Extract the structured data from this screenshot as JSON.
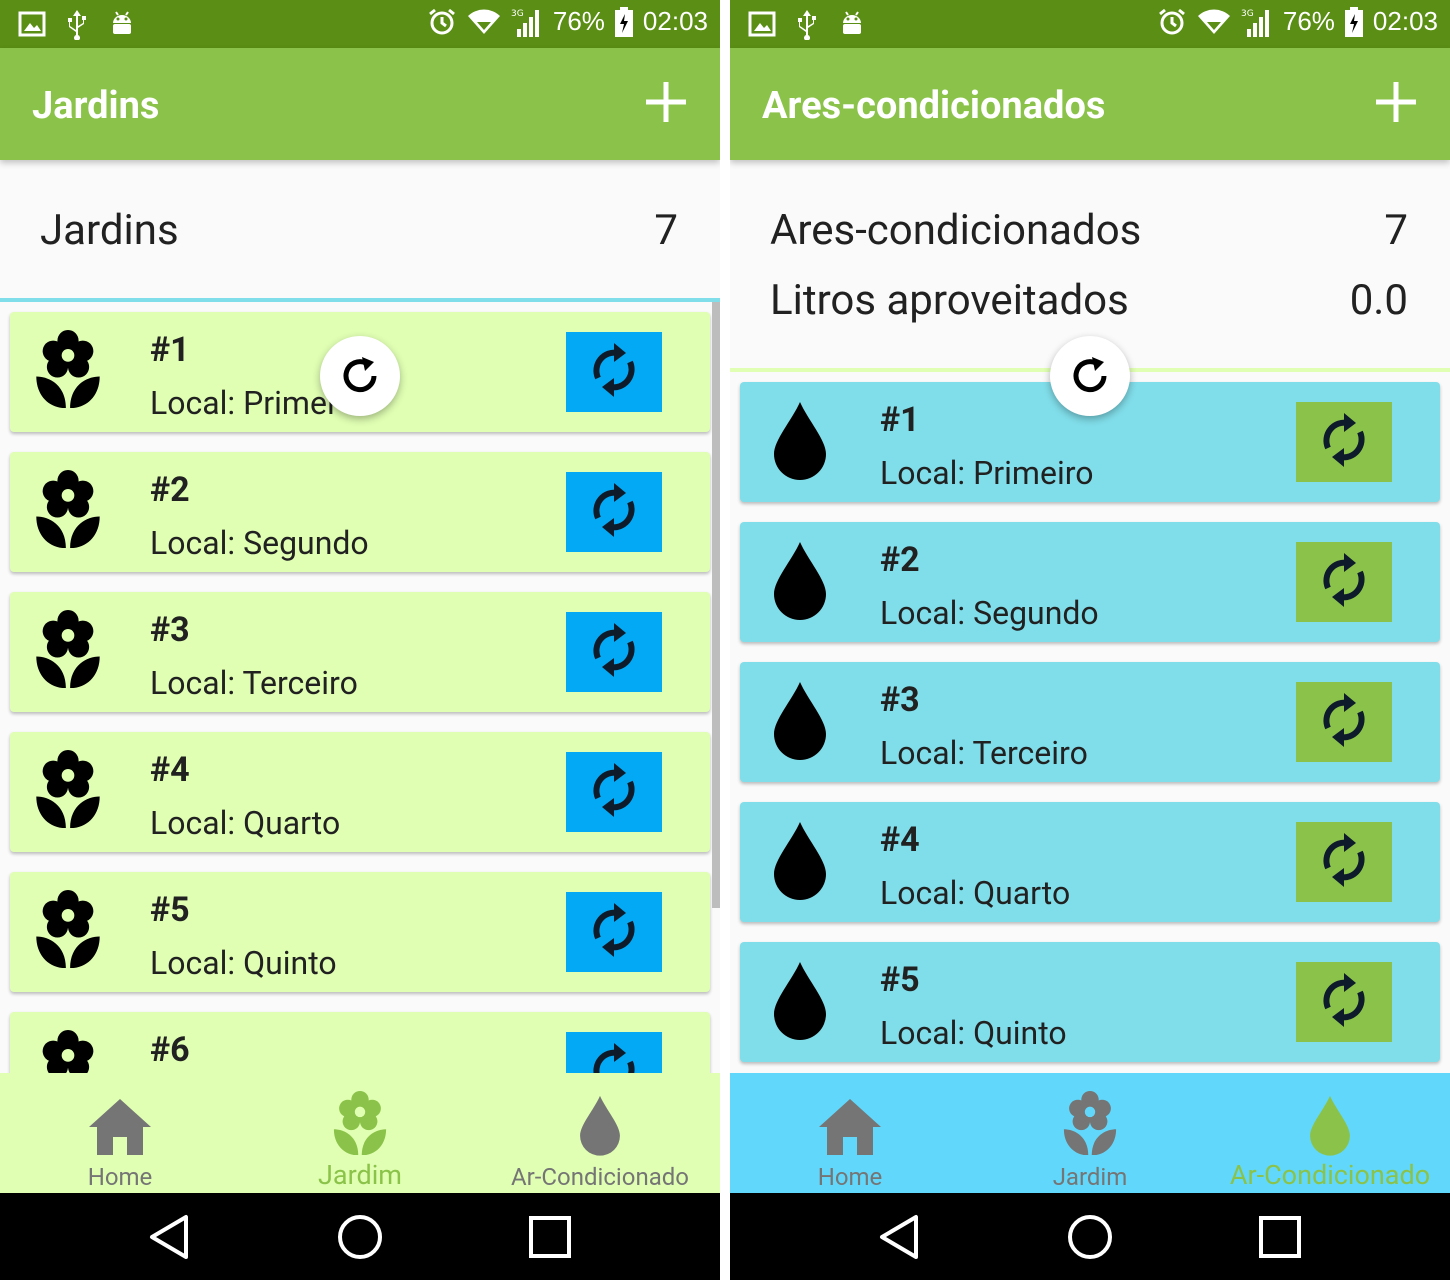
{
  "status": {
    "battery": "76%",
    "time": "02:03",
    "network": "3G"
  },
  "colors": {
    "status_bar": "#5a8e14",
    "app_bar": "#8bc34a",
    "garden_card": "#e0ffb3",
    "garden_sync": "#03a9f4",
    "ac_card": "#80deea",
    "ac_sync": "#8bc34a",
    "nav_left_bg": "#e0ffb3",
    "nav_right_bg": "#61d8fb",
    "nav_active_left": "#8bc34a",
    "nav_active_right": "#8bc34a",
    "nav_inactive": "#757575"
  },
  "left_screen": {
    "title": "Jardins",
    "summary": {
      "label": "Jardins",
      "count": "7"
    },
    "items": [
      {
        "num": "#1",
        "local": "Local: Primei"
      },
      {
        "num": "#2",
        "local": "Local: Segundo"
      },
      {
        "num": "#3",
        "local": "Local: Terceiro"
      },
      {
        "num": "#4",
        "local": "Local: Quarto"
      },
      {
        "num": "#5",
        "local": "Local: Quinto"
      },
      {
        "num": "#6",
        "local": ""
      }
    ],
    "nav": [
      {
        "label": "Home",
        "icon": "home-icon"
      },
      {
        "label": "Jardim",
        "icon": "flower-icon"
      },
      {
        "label": "Ar-Condicionado",
        "icon": "drop-icon"
      }
    ],
    "active_nav": 1
  },
  "right_screen": {
    "title": "Ares-condicionados",
    "summary": [
      {
        "label": "Ares-condicionados",
        "value": "7"
      },
      {
        "label": "Litros aproveitados",
        "value": "0.0"
      }
    ],
    "items": [
      {
        "num": "#1",
        "local": "Local: Primeiro"
      },
      {
        "num": "#2",
        "local": "Local: Segundo"
      },
      {
        "num": "#3",
        "local": "Local: Terceiro"
      },
      {
        "num": "#4",
        "local": "Local: Quarto"
      },
      {
        "num": "#5",
        "local": "Local: Quinto"
      }
    ],
    "nav": [
      {
        "label": "Home",
        "icon": "home-icon"
      },
      {
        "label": "Jardim",
        "icon": "flower-icon"
      },
      {
        "label": "Ar-Condicionado",
        "icon": "drop-icon"
      }
    ],
    "active_nav": 2
  }
}
